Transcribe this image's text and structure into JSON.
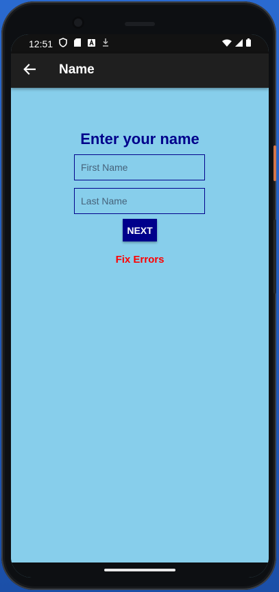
{
  "status_bar": {
    "time": "12:51",
    "left_icons": [
      "shield-icon",
      "sd-card-icon",
      "a-notification-icon",
      "download-icon"
    ],
    "right_icons": [
      "wifi-icon",
      "signal-icon",
      "battery-icon"
    ]
  },
  "app_bar": {
    "title": "Name",
    "back_icon": "arrow-back-icon"
  },
  "form": {
    "heading": "Enter your name",
    "first_name_placeholder": "First Name",
    "first_name_value": "",
    "last_name_placeholder": "Last Name",
    "last_name_value": "",
    "next_label": "NEXT",
    "error_message": "Fix Errors"
  },
  "colors": {
    "background": "#87ceeb",
    "primary": "#00008b",
    "error": "#ff0000",
    "app_bar": "#1f1f1f"
  }
}
